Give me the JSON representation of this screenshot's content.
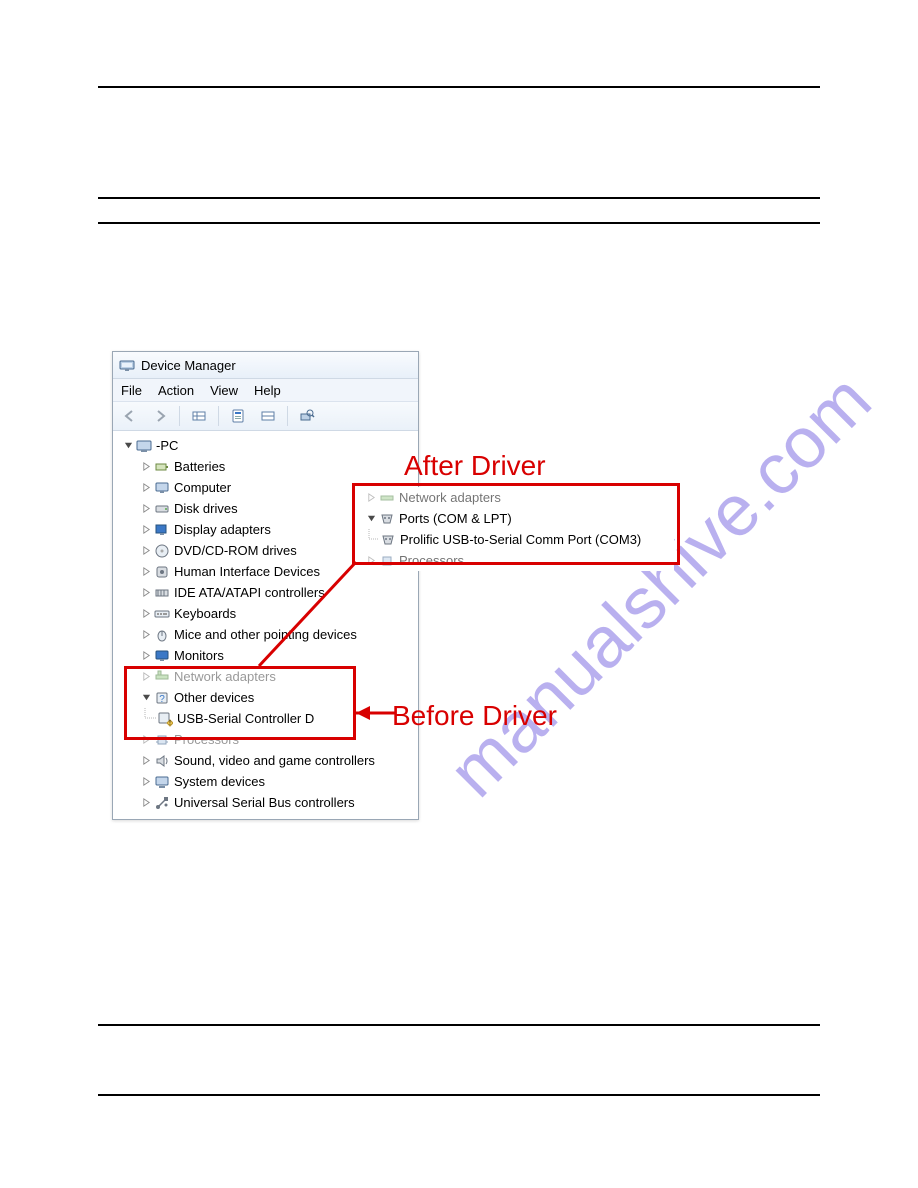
{
  "rules": {
    "top1": 86,
    "top2": 197,
    "top3": 222,
    "top4": 1024,
    "top5": 1094
  },
  "watermark": "manualshive.com",
  "window": {
    "title": "Device Manager",
    "menus": {
      "file": "File",
      "action": "Action",
      "view": "View",
      "help": "Help"
    },
    "root_label": "-PC",
    "categories": {
      "batteries": "Batteries",
      "computer": "Computer",
      "disk_drives": "Disk drives",
      "display_adapters": "Display adapters",
      "dvd_cd": "DVD/CD-ROM drives",
      "hid": "Human Interface Devices",
      "ide": "IDE ATA/ATAPI controllers",
      "keyboards": "Keyboards",
      "mice": "Mice and other pointing devices",
      "monitors": "Monitors",
      "network_adapters": "Network adapters",
      "other_devices": "Other devices",
      "usb_serial_controller_d": "USB-Serial Controller D",
      "processors": "Processors",
      "sound": "Sound, video and game controllers",
      "system_devices": "System devices",
      "usb_controllers": "Universal Serial Bus controllers"
    }
  },
  "after_inset": {
    "network_adapters": "Network adapters",
    "ports": "Ports (COM & LPT)",
    "prolific": "Prolific USB-to-Serial Comm Port (COM3)",
    "processors": "Processors"
  },
  "annotations": {
    "after": "After Driver",
    "before": "Before Driver"
  }
}
